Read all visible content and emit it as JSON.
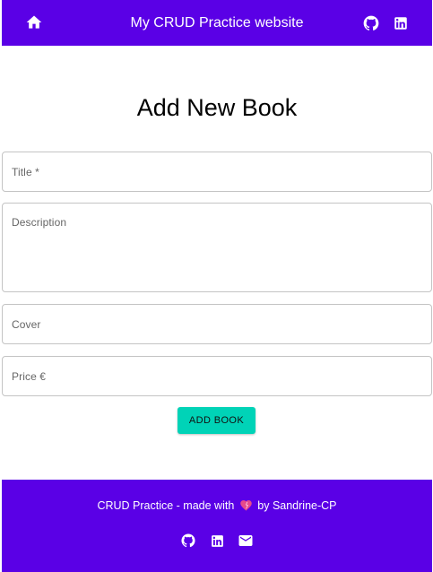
{
  "header": {
    "site_title": "My CRUD Practice website",
    "icons": [
      "home-icon",
      "github-icon",
      "linkedin-icon"
    ]
  },
  "form": {
    "title": "Add New Book",
    "fields": {
      "title_label": "Title",
      "title_required_mark": " *",
      "description_label": "Description",
      "cover_label": "Cover",
      "price_label": "Price €"
    },
    "submit_label": "ADD BOOK"
  },
  "footer": {
    "credit_before": "CRUD Practice - made with",
    "credit_after": "by Sandrine-CP",
    "icons": [
      "github-icon",
      "linkedin-icon",
      "mail-icon",
      "heart-icon"
    ]
  },
  "colors": {
    "brand": "#5a00e6",
    "accent": "#00d3b7",
    "border": "#c4c4c4",
    "heart": "#e64a8b"
  }
}
